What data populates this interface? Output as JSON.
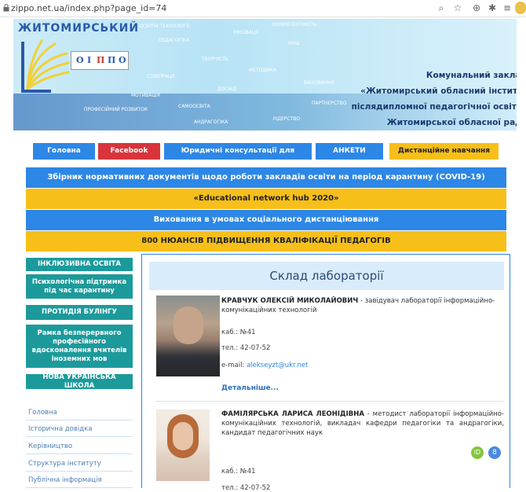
{
  "browser": {
    "url": "zippo.net.ua/index.php?page_id=74"
  },
  "header": {
    "logo_word": "ЖИТОМИРСЬКИЙ",
    "logo_letters": [
      "О",
      "І",
      "П",
      "П",
      "О"
    ],
    "institute_lines": [
      "Комунальний заклад",
      "«Житомирський обласний інститут",
      "післядипломної педагогічної освіти»",
      "Житомирської обласної ради"
    ],
    "tag_cloud": [
      "ОСВІТНІ ТЕХНОЛОГІЇ",
      "ІННОВАЦІЇ",
      "ПЕДАГОГІКА",
      "КОМПЕТЕНТНІСТЬ",
      "ТВОРЧІСТЬ",
      "МЕТОДИКА",
      "САМООСВІТА",
      "ПАРТНЕРСТВО",
      "НУШ",
      "СПІВПРАЦЯ",
      "ДОСВІД",
      "ПРОФЕСІЙНИЙ РОЗВИТОК",
      "ЛІДЕРСТВО",
      "АНДРАГОГІКА",
      "ВИХОВАННЯ",
      "МОТИВАЦІЯ"
    ]
  },
  "nav": {
    "items": [
      {
        "label": "Головна",
        "color": "#2d87e6"
      },
      {
        "label": "Facebook",
        "color": "#d9343b"
      },
      {
        "label": "Юридичні консультації для педагогів",
        "color": "#2d87e6"
      },
      {
        "label": "АНКЕТИ",
        "color": "#2d87e6"
      },
      {
        "label": "Дистанційне навчання",
        "color": "#f7bf1a"
      }
    ]
  },
  "bands": [
    "Збірник нормативних документів щодо роботи закладів освіти на період карантину (COVID-19)",
    "«Educational network hub 2020»",
    "Виховання в умовах соціального дистанціювання",
    "800 НЮАНСІВ ПІДВИЩЕННЯ КВАЛІФІКАЦІЇ ПЕДАГОГІВ"
  ],
  "sidebar": {
    "buttons": [
      "ІНКЛЮЗИВНА ОСВІТА",
      "Психологічна підтримка під час карантину",
      "ПРОТИДІЯ БУЛІНГУ",
      "Рамка безперервного професійного вдосконалення вчителів іноземних мов",
      "НОВА УКРАЇНСЬКА ШКОЛА"
    ],
    "links": [
      "Головна",
      "Історична довідка",
      "Керівництво",
      "Структура інституту",
      "Публічна інформація"
    ]
  },
  "main": {
    "title": "Склад лабораторії",
    "people": [
      {
        "name": "КРАВЧУК ОЛЕКСІЙ МИКОЛАЙОВИЧ",
        "role": " - завідувач лабораторії інформаційно-комунікаційних технологій",
        "room": "каб.: №41",
        "phone": "тел.: 42-07-52",
        "email_label": "e-mail: ",
        "email": "alekseyzt@ukr.net",
        "more": "Детальніше..."
      },
      {
        "name": "ФАМІЛЯРСЬКА ЛАРИСА ЛЕОНІДІВНА",
        "role": " - методист лабораторії інформаційно-комунікаційних технологій, викладач кафедри педагогіки та андрагогіки, кандидат педагогічних наук",
        "room": "каб.: №41",
        "phone": "тел.: 42-07-52",
        "orcid_label": "iD",
        "scholar_label": "8"
      }
    ]
  }
}
